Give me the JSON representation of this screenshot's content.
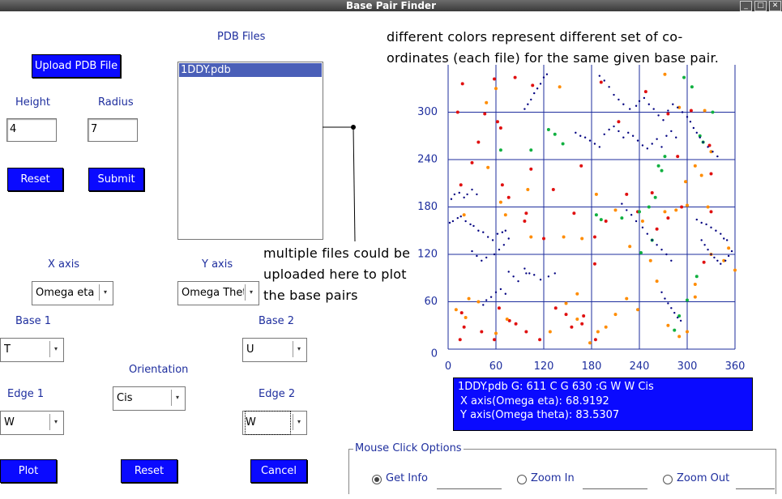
{
  "window": {
    "title": "Base Pair Finder"
  },
  "upload": {
    "label": "Upload PDB File"
  },
  "pdb": {
    "header": "PDB Files",
    "files": [
      "1DDY.pdb"
    ]
  },
  "height": {
    "label": "Height",
    "value": "4"
  },
  "radius": {
    "label": "Radius",
    "value": "7"
  },
  "top_buttons": {
    "reset": "Reset",
    "submit": "Submit"
  },
  "axes_select": {
    "x_label": "X axis",
    "x_value": "Omega eta",
    "y_label": "Y axis",
    "y_value": "Omega Thet"
  },
  "base1": {
    "label": "Base 1",
    "value": "T"
  },
  "base2": {
    "label": "Base 2",
    "value": "U"
  },
  "orientation": {
    "label": "Orientation",
    "value": "Cis"
  },
  "edge1": {
    "label": "Edge 1",
    "value": "W"
  },
  "edge2": {
    "label": "Edge 2",
    "value": "W"
  },
  "bottom_buttons": {
    "plot": "Plot",
    "reset": "Reset",
    "cancel": "Cancel"
  },
  "annotations": {
    "colors_line1": "different colors represent different set of co-",
    "colors_line2": "ordinates (each file) for the same given base pair.",
    "multi_line1": "multiple files could be",
    "multi_line2": "uploaded here to plot",
    "multi_line3": "the base pairs"
  },
  "info": {
    "line1": "1DDY.pdb G: 611 C G 630 :G W W Cis",
    "line2": "X axis(Omega eta): 68.9192",
    "line3": "Y axis(Omega theta): 83.5307"
  },
  "mouse": {
    "legend": "Mouse Click Options",
    "options": [
      "Get Info",
      "Zoom In",
      "Zoom Out"
    ],
    "selected": "Get Info"
  },
  "colors": {
    "accent": "#0a0aff",
    "grid": "#1e2e9e",
    "red": "#e01010",
    "orange": "#ff8c00",
    "green": "#10b040",
    "navy": "#000080"
  },
  "chart_data": {
    "type": "scatter",
    "xlim": [
      0,
      360
    ],
    "ylim": [
      0,
      360
    ],
    "xticks": [
      0,
      60,
      120,
      180,
      240,
      300,
      360
    ],
    "yticks": [
      0,
      60,
      120,
      180,
      240,
      300
    ],
    "grid": true,
    "series": [
      {
        "color": "#e01010",
        "points": [
          [
            15,
            12
          ],
          [
            17,
            46
          ],
          [
            20,
            28
          ],
          [
            42,
            22
          ],
          [
            58,
            12
          ],
          [
            64,
            52
          ],
          [
            77,
            36
          ],
          [
            85,
            32
          ],
          [
            98,
            22
          ],
          [
            115,
            12
          ],
          [
            135,
            52
          ],
          [
            148,
            44
          ],
          [
            155,
            28
          ],
          [
            168,
            32
          ],
          [
            170,
            42
          ],
          [
            185,
            12
          ],
          [
            16,
            208
          ],
          [
            30,
            236
          ],
          [
            38,
            262
          ],
          [
            58,
            342
          ],
          [
            66,
            280
          ],
          [
            68,
            208
          ],
          [
            76,
            192
          ],
          [
            96,
            162
          ],
          [
            98,
            172
          ],
          [
            104,
            228
          ],
          [
            120,
            140
          ],
          [
            132,
            202
          ],
          [
            158,
            172
          ],
          [
            167,
            232
          ],
          [
            184,
            108
          ],
          [
            184,
            142
          ],
          [
            198,
            162
          ],
          [
            224,
            196
          ],
          [
            238,
            174
          ],
          [
            262,
            152
          ],
          [
            276,
            166
          ],
          [
            293,
            180
          ],
          [
            321,
            110
          ],
          [
            330,
            174
          ],
          [
            12,
            300
          ],
          [
            18,
            336
          ],
          [
            46,
            298
          ],
          [
            62,
            288
          ],
          [
            84,
            344
          ],
          [
            106,
            334
          ],
          [
            192,
            338
          ],
          [
            256,
            198
          ],
          [
            305,
            302
          ],
          [
            328,
            258
          ],
          [
            330,
            222
          ],
          [
            276,
            298
          ],
          [
            288,
            244
          ],
          [
            214,
            288
          ],
          [
            248,
            326
          ]
        ]
      },
      {
        "color": "#ff8c00",
        "points": [
          [
            10,
            50
          ],
          [
            22,
            40
          ],
          [
            26,
            64
          ],
          [
            38,
            60
          ],
          [
            60,
            20
          ],
          [
            74,
            38
          ],
          [
            128,
            22
          ],
          [
            148,
            58
          ],
          [
            162,
            38
          ],
          [
            178,
            8
          ],
          [
            188,
            22
          ],
          [
            198,
            28
          ],
          [
            210,
            44
          ],
          [
            224,
            64
          ],
          [
            238,
            50
          ],
          [
            276,
            30
          ],
          [
            290,
            16
          ],
          [
            300,
            22
          ],
          [
            310,
            66
          ],
          [
            310,
            82
          ],
          [
            20,
            170
          ],
          [
            50,
            230
          ],
          [
            66,
            186
          ],
          [
            72,
            170
          ],
          [
            100,
            202
          ],
          [
            104,
            142
          ],
          [
            145,
            142
          ],
          [
            162,
            70
          ],
          [
            168,
            140
          ],
          [
            186,
            196
          ],
          [
            210,
            176
          ],
          [
            228,
            130
          ],
          [
            244,
            162
          ],
          [
            254,
            112
          ],
          [
            262,
            86
          ],
          [
            272,
            174
          ],
          [
            286,
            176
          ],
          [
            298,
            212
          ],
          [
            318,
            220
          ],
          [
            326,
            180
          ],
          [
            330,
            120
          ],
          [
            346,
            112
          ],
          [
            352,
            128
          ],
          [
            360,
            100
          ],
          [
            48,
            312
          ],
          [
            60,
            330
          ],
          [
            140,
            332
          ],
          [
            272,
            348
          ],
          [
            290,
            306
          ],
          [
            300,
            182
          ],
          [
            322,
            302
          ],
          [
            310,
            232
          ],
          [
            330,
            250
          ]
        ]
      },
      {
        "color": "#10b040",
        "points": [
          [
            66,
            252
          ],
          [
            104,
            252
          ],
          [
            126,
            278
          ],
          [
            134,
            272
          ],
          [
            144,
            260
          ],
          [
            186,
            170
          ],
          [
            192,
            164
          ],
          [
            218,
            166
          ],
          [
            242,
            122
          ],
          [
            256,
            138
          ],
          [
            260,
            192
          ],
          [
            264,
            232
          ],
          [
            272,
            244
          ],
          [
            296,
            344
          ],
          [
            306,
            332
          ],
          [
            320,
            262
          ],
          [
            332,
            300
          ],
          [
            316,
            270
          ],
          [
            284,
            24
          ],
          [
            290,
            42
          ],
          [
            300,
            62
          ],
          [
            312,
            92
          ],
          [
            240,
            174
          ],
          [
            252,
            180
          ],
          [
            268,
            226
          ]
        ]
      },
      {
        "color": "#000080",
        "points": [
          [
            4,
            190
          ],
          [
            8,
            196
          ],
          [
            14,
            198
          ],
          [
            20,
            192
          ],
          [
            24,
            196
          ],
          [
            30,
            202
          ],
          [
            36,
            196
          ],
          [
            2,
            160
          ],
          [
            6,
            162
          ],
          [
            12,
            166
          ],
          [
            16,
            168
          ],
          [
            22,
            162
          ],
          [
            28,
            158
          ],
          [
            32,
            156
          ],
          [
            38,
            150
          ],
          [
            44,
            148
          ],
          [
            50,
            142
          ],
          [
            56,
            138
          ],
          [
            62,
            146
          ],
          [
            68,
            148
          ],
          [
            72,
            150
          ],
          [
            76,
            140
          ],
          [
            30,
            124
          ],
          [
            36,
            118
          ],
          [
            42,
            112
          ],
          [
            48,
            116
          ],
          [
            58,
            120
          ],
          [
            64,
            126
          ],
          [
            70,
            132
          ],
          [
            76,
            98
          ],
          [
            82,
            92
          ],
          [
            88,
            86
          ],
          [
            96,
            102
          ],
          [
            102,
            96
          ],
          [
            44,
            56
          ],
          [
            48,
            62
          ],
          [
            54,
            66
          ],
          [
            60,
            72
          ],
          [
            66,
            76
          ],
          [
            72,
            70
          ],
          [
            98,
            96
          ],
          [
            108,
            94
          ],
          [
            116,
            88
          ],
          [
            126,
            92
          ],
          [
            134,
            96
          ],
          [
            160,
            274
          ],
          [
            166,
            270
          ],
          [
            172,
            268
          ],
          [
            178,
            264
          ],
          [
            184,
            260
          ],
          [
            190,
            256
          ],
          [
            196,
            272
          ],
          [
            202,
            278
          ],
          [
            208,
            282
          ],
          [
            214,
            276
          ],
          [
            220,
            268
          ],
          [
            226,
            274
          ],
          [
            232,
            270
          ],
          [
            238,
            264
          ],
          [
            244,
            258
          ],
          [
            250,
            254
          ],
          [
            256,
            260
          ],
          [
            262,
            266
          ],
          [
            268,
            256
          ],
          [
            274,
            270
          ],
          [
            280,
            276
          ],
          [
            286,
            268
          ],
          [
            190,
            346
          ],
          [
            196,
            340
          ],
          [
            202,
            332
          ],
          [
            208,
            322
          ],
          [
            214,
            316
          ],
          [
            220,
            310
          ],
          [
            228,
            304
          ],
          [
            236,
            308
          ],
          [
            240,
            314
          ],
          [
            246,
            318
          ],
          [
            252,
            310
          ],
          [
            258,
            304
          ],
          [
            264,
            296
          ],
          [
            270,
            290
          ],
          [
            276,
            302
          ],
          [
            282,
            310
          ],
          [
            288,
            306
          ],
          [
            294,
            300
          ],
          [
            300,
            294
          ],
          [
            304,
            288
          ],
          [
            308,
            280
          ],
          [
            312,
            274
          ],
          [
            316,
            268
          ],
          [
            320,
            262
          ],
          [
            326,
            256
          ],
          [
            332,
            250
          ],
          [
            338,
            244
          ],
          [
            312,
            164
          ],
          [
            318,
            160
          ],
          [
            324,
            158
          ],
          [
            330,
            154
          ],
          [
            336,
            150
          ],
          [
            342,
            146
          ],
          [
            346,
            140
          ],
          [
            350,
            138
          ],
          [
            318,
            138
          ],
          [
            322,
            132
          ],
          [
            326,
            126
          ],
          [
            330,
            120
          ],
          [
            334,
            116
          ],
          [
            338,
            112
          ],
          [
            342,
            108
          ],
          [
            348,
            112
          ],
          [
            352,
            118
          ],
          [
            356,
            124
          ],
          [
            218,
            184
          ],
          [
            224,
            176
          ],
          [
            230,
            170
          ],
          [
            236,
            162
          ],
          [
            244,
            154
          ],
          [
            250,
            146
          ],
          [
            256,
            138
          ],
          [
            262,
            132
          ],
          [
            268,
            126
          ],
          [
            274,
            120
          ],
          [
            280,
            112
          ],
          [
            268,
            72
          ],
          [
            272,
            64
          ],
          [
            276,
            58
          ],
          [
            280,
            52
          ],
          [
            284,
            46
          ],
          [
            288,
            40
          ],
          [
            292,
            36
          ],
          [
            96,
            304
          ],
          [
            100,
            310
          ],
          [
            104,
            316
          ],
          [
            108,
            324
          ],
          [
            112,
            330
          ],
          [
            116,
            336
          ],
          [
            120,
            344
          ],
          [
            124,
            348
          ]
        ]
      }
    ]
  }
}
